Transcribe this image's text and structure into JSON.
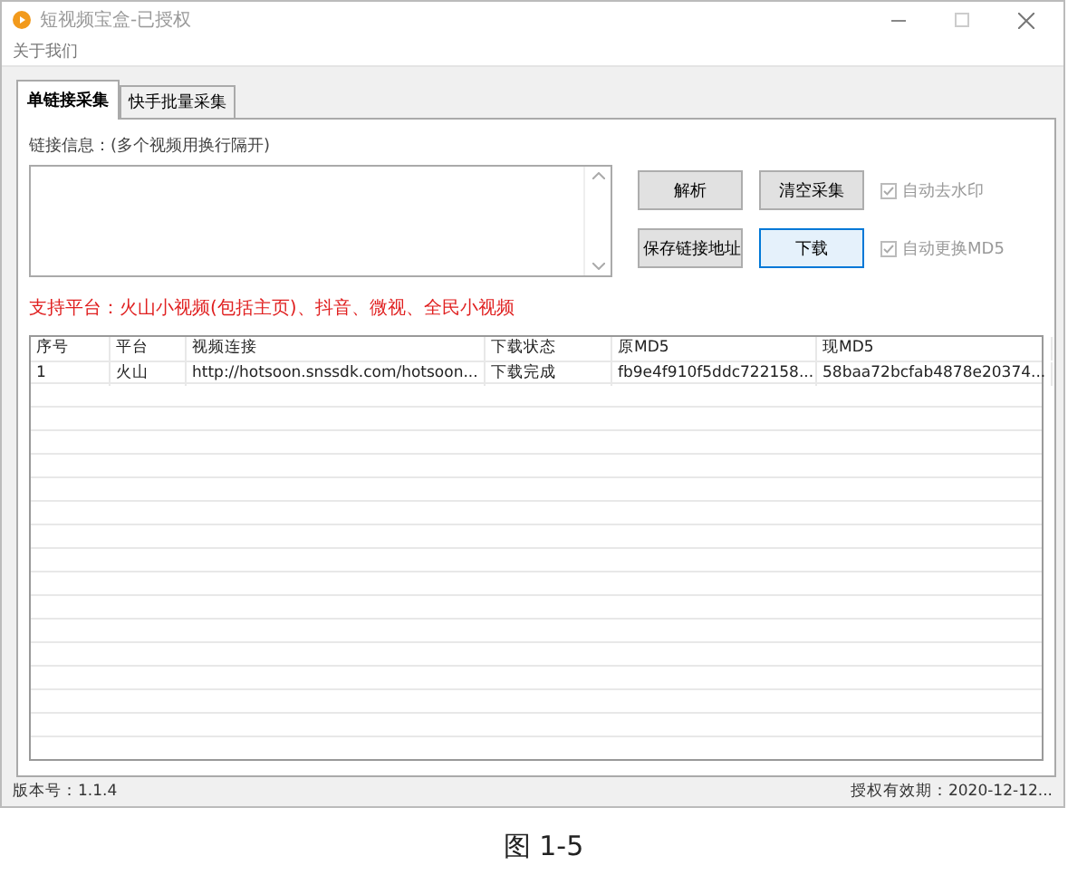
{
  "window": {
    "title": "短视频宝盒-已授权"
  },
  "menu": [
    "关于我们"
  ],
  "tabs": [
    {
      "label": "单链接采集",
      "selected": true
    },
    {
      "label": "快手批量采集",
      "selected": false
    }
  ],
  "link_input": {
    "label": "链接信息：(多个视频用换行隔开)"
  },
  "buttons": [
    {
      "label": "解析",
      "focused": false
    },
    {
      "label": "清空采集",
      "focused": false
    },
    {
      "label": "保存链接地址",
      "focused": false
    },
    {
      "label": "下载",
      "focused": true
    }
  ],
  "options": [
    {
      "label": "自动去水印",
      "checked": true,
      "disabled": true
    },
    {
      "label": "自动更换MD5",
      "checked": true,
      "disabled": true
    }
  ],
  "platforms_note": "支持平台：火山小视频(包括主页)、抖音、微视、全民小视频",
  "table": {
    "columns": [
      "序号",
      "平台",
      "视频连接",
      "下载状态",
      "原MD5",
      "现MD5"
    ],
    "rows": [
      [
        "1",
        "火山",
        "http://hotsoon.snssdk.com/hotsoon...",
        "下载完成",
        "fb9e4f910f5ddc722158...",
        "58baa72bcfab4878e20374..."
      ]
    ]
  },
  "status_bar": {
    "version": "版本号：1.1.4",
    "license": "授权有效期：2020-12-12..."
  },
  "caption": "图 1-5"
}
